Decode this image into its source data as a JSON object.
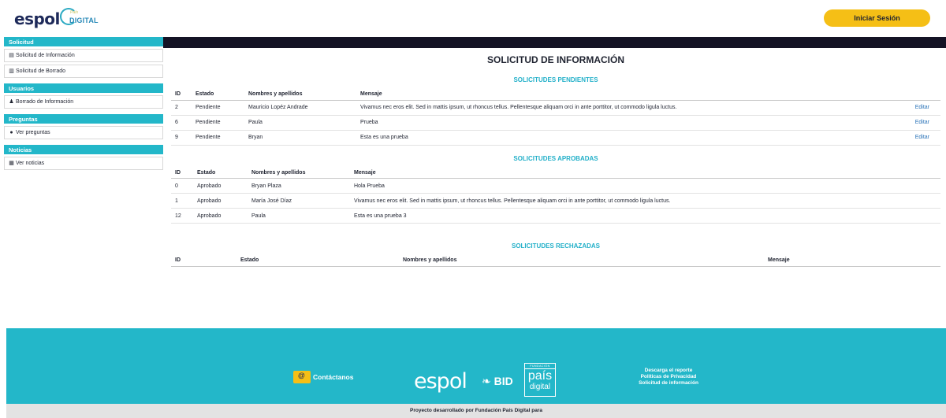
{
  "header": {
    "logo_espol": "espol",
    "logo_digital_small": "País",
    "logo_digital_big": "DIGITAL",
    "login_label": "Iniciar Sesión"
  },
  "sidebar": {
    "sections": [
      {
        "title": "Solicitud",
        "items": [
          {
            "label": "Solicitud de Información",
            "icon": "document-icon"
          },
          {
            "label": "Solicitud de Borrado",
            "icon": "trash-icon"
          }
        ]
      },
      {
        "title": "Usuarios",
        "items": [
          {
            "label": "Borrado de Información",
            "icon": "users-icon"
          }
        ]
      },
      {
        "title": "Preguntas",
        "items": [
          {
            "label": "Ver preguntas",
            "icon": "question-circle-icon"
          }
        ]
      },
      {
        "title": "Noticias",
        "items": [
          {
            "label": "Ver noticias",
            "icon": "newspaper-icon"
          }
        ]
      }
    ]
  },
  "main": {
    "title": "SOLICITUD DE INFORMACIÓN",
    "pending": {
      "title": "SOLICITUDES PENDIENTES",
      "headers": [
        "ID",
        "Estado",
        "Nombres y apellidos",
        "Mensaje"
      ],
      "rows": [
        {
          "id": "2",
          "estado": "Pendiente",
          "nombre": "Mauricio Lopéz Andrade",
          "mensaje": "Vivamus nec eros elit. Sed in mattis ipsum, ut rhoncus tellus. Pellentesque aliquam orci in ante porttitor, ut commodo ligula luctus.",
          "action": "Editar"
        },
        {
          "id": "6",
          "estado": "Pendiente",
          "nombre": "Paula",
          "mensaje": "Prueba",
          "action": "Editar"
        },
        {
          "id": "9",
          "estado": "Pendiente",
          "nombre": "Bryan",
          "mensaje": "Esta es una prueba",
          "action": "Editar"
        }
      ]
    },
    "approved": {
      "title": "SOLICITUDES APROBADAS",
      "headers": [
        "ID",
        "Estado",
        "Nombres y apellidos",
        "Mensaje"
      ],
      "rows": [
        {
          "id": "0",
          "estado": "Aprobado",
          "nombre": "Bryan Plaza",
          "mensaje": "Hola Prueba"
        },
        {
          "id": "1",
          "estado": "Aprobado",
          "nombre": "María José Díaz",
          "mensaje": "Vivamus nec eros elit. Sed in mattis ipsum, ut rhoncus tellus. Pellentesque aliquam orci in ante porttitor, ut commodo ligula luctus."
        },
        {
          "id": "12",
          "estado": "Aprobado",
          "nombre": "Paula",
          "mensaje": "Esta es una prueba 3"
        }
      ]
    },
    "rejected": {
      "title": "SOLICITUDES RECHAZADAS",
      "headers": [
        "ID",
        "Estado",
        "Nombres y apellidos",
        "Mensaje"
      ]
    }
  },
  "footer": {
    "contact": "Contáctanos",
    "espol": "espol",
    "bid": "BID",
    "fundacion": "FUNDACIÓN",
    "pais": "país",
    "digital": "digital",
    "links": [
      "Descarga el reporte",
      "Políticas de Privacidad",
      "Solicitud de información"
    ],
    "credit_line": "Proyecto desarrollado por Fundación País Digital para"
  },
  "colors": {
    "accent": "#23b7c9",
    "button": "#f5bf16",
    "topbar": "#141325",
    "link": "#2a73b8"
  }
}
